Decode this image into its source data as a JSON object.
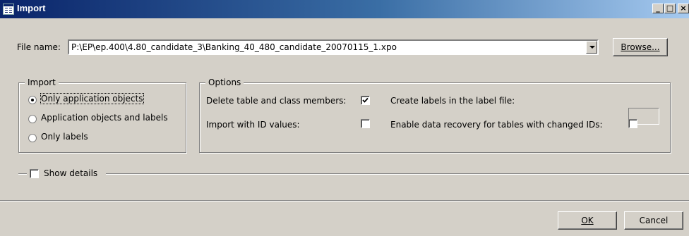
{
  "window": {
    "title": "Import",
    "controls": {
      "minimize": "_",
      "maximize": "□",
      "close": "×"
    }
  },
  "file": {
    "label": "File name:",
    "value": "P:\\EP\\ep.400\\4.80_candidate_3\\Banking_40_480_candidate_20070115_1.xpo",
    "browse_label": "Browse..."
  },
  "import_group": {
    "legend": "Import",
    "options": [
      {
        "label": "Only application objects",
        "selected": true
      },
      {
        "label": "Application objects and labels",
        "selected": false
      },
      {
        "label": "Only labels",
        "selected": false
      }
    ]
  },
  "options_group": {
    "legend": "Options",
    "delete_members": {
      "label": "Delete table and class members:",
      "checked": true
    },
    "import_ids": {
      "label": "Import with ID values:",
      "checked": false
    },
    "create_labels": {
      "label": "Create labels in the label file:",
      "value": ""
    },
    "data_recovery": {
      "label": "Enable data recovery for tables with changed IDs:",
      "checked": false
    }
  },
  "details": {
    "label": "Show details",
    "checked": false
  },
  "footer": {
    "ok_label": "OK",
    "cancel_label": "Cancel"
  }
}
